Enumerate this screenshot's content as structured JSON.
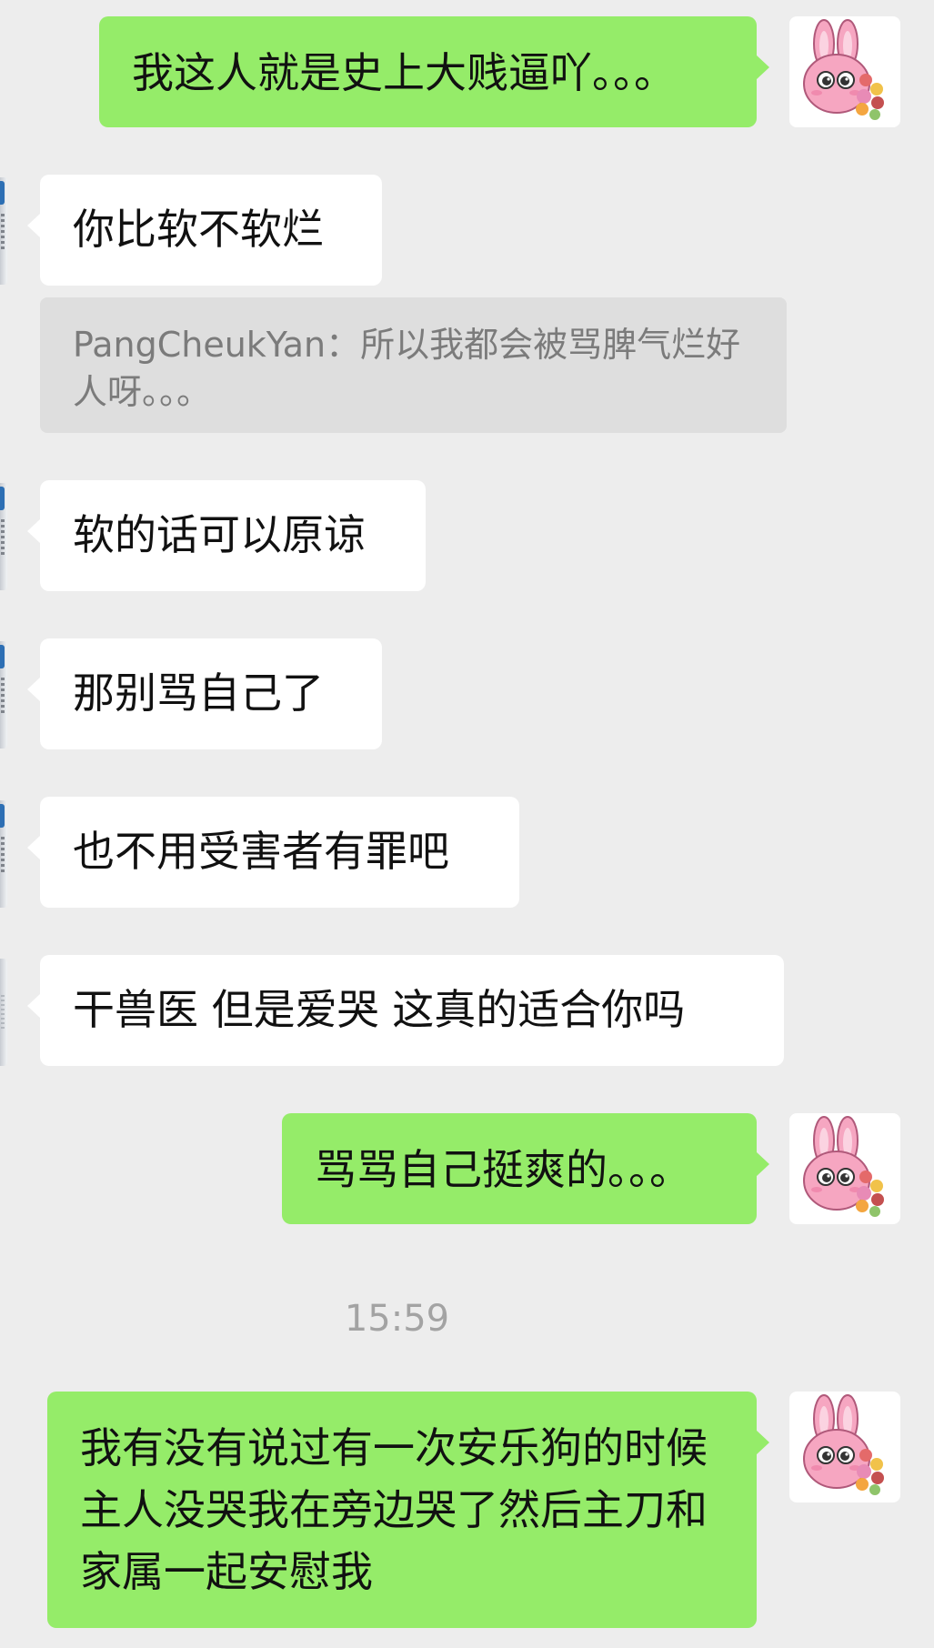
{
  "chat": {
    "messages": [
      {
        "sender": "self",
        "text": "我这人就是史上大贱逼吖。。。"
      },
      {
        "sender": "other",
        "text": "你比软不软烂"
      },
      {
        "sender": "other",
        "text": "软的话可以原谅"
      },
      {
        "sender": "other",
        "text": "那别骂自己了"
      },
      {
        "sender": "other",
        "text": "也不用受害者有罪吧"
      },
      {
        "sender": "other",
        "text": "干兽医 但是爱哭  这真的适合你吗"
      },
      {
        "sender": "self",
        "text": "骂骂自己挺爽的。。。"
      },
      {
        "sender": "self",
        "text": "我有没有说过有一次安乐狗的时候主人没哭我在旁边哭了然后主刀和家属一起安慰我"
      }
    ],
    "quote": {
      "author": "PangCheukYan",
      "separator": "：",
      "text": "所以我都会被骂脾气烂好人呀。。。"
    },
    "timestamp": "15:59"
  },
  "avatars": {
    "self": "pink-bunny-holding-flowers-icon",
    "other": "cropped-contact-avatar"
  },
  "colors": {
    "background": "#ededed",
    "self_bubble": "#95ec69",
    "other_bubble": "#ffffff",
    "quote_bg": "#dedede",
    "quote_text": "#7b7b7b",
    "timestamp_text": "#a3a3a3"
  }
}
